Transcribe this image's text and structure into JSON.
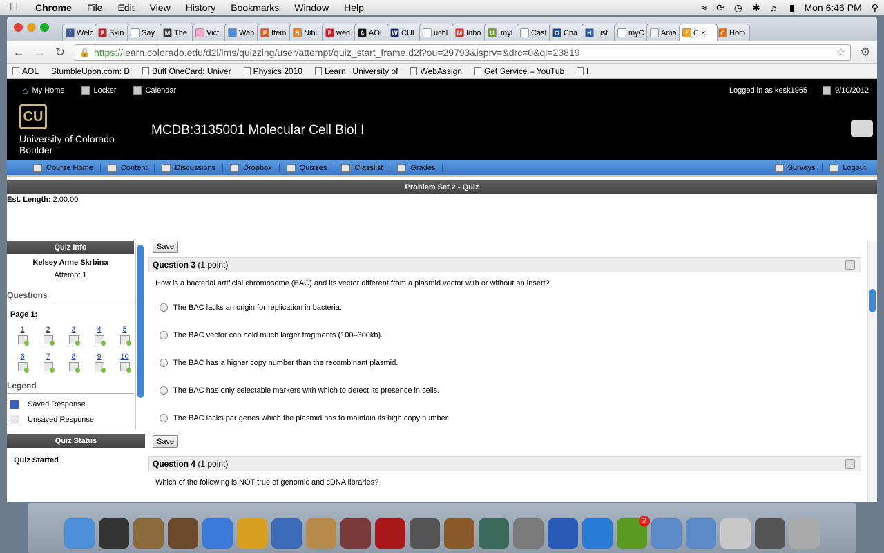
{
  "menubar": {
    "apple": "",
    "app_name": "Chrome",
    "items": [
      "File",
      "Edit",
      "View",
      "History",
      "Bookmarks",
      "Window",
      "Help"
    ],
    "clock": "Mon 6:46 PM"
  },
  "tabs": [
    {
      "label": "Welc",
      "color": "#3b5998",
      "glyph": "f"
    },
    {
      "label": "Skin",
      "color": "#cb2027",
      "glyph": "P"
    },
    {
      "label": "Say",
      "color": "#ffffff",
      "glyph": ""
    },
    {
      "label": "The",
      "color": "#333333",
      "glyph": "M"
    },
    {
      "label": "Vict",
      "color": "#f4a6c6",
      "glyph": ""
    },
    {
      "label": "Wan",
      "color": "#4a8fd8",
      "glyph": ""
    },
    {
      "label": "Item",
      "color": "#e0541c",
      "glyph": "E"
    },
    {
      "label": "Nibl",
      "color": "#f57d00",
      "glyph": "B"
    },
    {
      "label": "wed",
      "color": "#cb2027",
      "glyph": "P"
    },
    {
      "label": "AOL",
      "color": "#111111",
      "glyph": "A"
    },
    {
      "label": "CUL",
      "color": "#1a2b6d",
      "glyph": "W"
    },
    {
      "label": "ucbl",
      "color": "#ffffff",
      "glyph": ""
    },
    {
      "label": "Inbo",
      "color": "#d93025",
      "glyph": "M"
    },
    {
      "label": ".myl",
      "color": "#6aa121",
      "glyph": "U"
    },
    {
      "label": "Cast",
      "color": "#ffffff",
      "glyph": ""
    },
    {
      "label": "Cha",
      "color": "#0d4aa8",
      "glyph": "O"
    },
    {
      "label": "List",
      "color": "#2a5aa8",
      "glyph": "H"
    },
    {
      "label": "myC",
      "color": "#ffffff",
      "glyph": ""
    },
    {
      "label": "Ama",
      "color": "#f0f0f0",
      "glyph": "a"
    },
    {
      "label": "C",
      "color": "#f7a21b",
      "glyph": "*",
      "active": true
    },
    {
      "label": "Hom",
      "color": "#f06a00",
      "glyph": "C"
    }
  ],
  "toolbar": {
    "scheme": "https://",
    "url": "learn.colorado.edu/d2l/lms/quizzing/user/attempt/quiz_start_frame.d2l?ou=29793&isprv=&drc=0&qi=23819"
  },
  "bookmarks": [
    "AOL",
    "StumbleUpon.com: D",
    "Buff OneCard: Univer",
    "Physics 2010",
    "Learn | University of",
    "WebAssign",
    "Get Service – YouTub",
    "l"
  ],
  "d2l": {
    "my_home": "My Home",
    "locker": "Locker",
    "calendar": "Calendar",
    "logged_in": "Logged in as kesk1965",
    "date": "9/10/2012",
    "logo_line1": "University of Colorado",
    "logo_line2": "Boulder",
    "course_title": "MCDB:3135001 Molecular Cell Biol I",
    "nav": [
      "Course Home",
      "Content",
      "Discussions",
      "Dropbox",
      "Quizzes",
      "Classlist",
      "Grades"
    ],
    "nav_right": [
      "Surveys",
      "Logout"
    ]
  },
  "quiz": {
    "title": "Problem Set 2 - Quiz",
    "est_label": "Est. Length:",
    "est_value": "2:00:00",
    "info_head": "Quiz Info",
    "student": "Kelsey Anne Skrbina",
    "attempt": "Attempt 1",
    "questions_label": "Questions",
    "page_label": "Page 1:",
    "question_numbers": [
      "1",
      "2",
      "3",
      "4",
      "5",
      "6",
      "7",
      "8",
      "9",
      "10"
    ],
    "legend_label": "Legend",
    "legend_saved": "Saved Response",
    "legend_unsaved": "Unsaved Response",
    "status_head": "Quiz Status",
    "status_text": "Quiz Started",
    "save_label": "Save",
    "q3": {
      "title": "Question 3",
      "points": "(1 point)",
      "text": "How is a bacterial artificial chromosome (BAC) and its vector different from a plasmid vector with or without an insert?",
      "options": [
        "The BAC lacks an origin for replication in bacteria.",
        "The BAC vector can hold much larger fragments (100–300kb).",
        "The BAC has a higher copy number than the recombinant plasmid.",
        "The BAC has only selectable markers with which to detect its presence in cells.",
        "The BAC lacks par genes which the plasmid has to maintain its high copy number."
      ]
    },
    "q4": {
      "title": "Question 4",
      "points": "(1 point)",
      "text": "Which of the following is NOT true of genomic and cDNA libraries?"
    }
  },
  "dock": {
    "items": [
      {
        "name": "finder-icon",
        "color": "#4a8fd8"
      },
      {
        "name": "dashboard-icon",
        "color": "#333"
      },
      {
        "name": "mail-stamp-icon",
        "color": "#8a6a3a"
      },
      {
        "name": "iphoto-icon",
        "color": "#6a4a2a"
      },
      {
        "name": "safari-icon",
        "color": "#3a7ad8"
      },
      {
        "name": "chrome-icon",
        "color": "#d8a020"
      },
      {
        "name": "facetime-icon",
        "color": "#3a6ab8"
      },
      {
        "name": "address-book-icon",
        "color": "#b88a4a"
      },
      {
        "name": "photo-booth-icon",
        "color": "#7a3a3a"
      },
      {
        "name": "movie-icon",
        "color": "#a81818"
      },
      {
        "name": "imovie-icon",
        "color": "#555"
      },
      {
        "name": "garageband-icon",
        "color": "#8a5a2a"
      },
      {
        "name": "time-machine-icon",
        "color": "#3a6a5a"
      },
      {
        "name": "system-preferences-icon",
        "color": "#7a7a7a"
      },
      {
        "name": "word-icon",
        "color": "#2a5ab8"
      },
      {
        "name": "hp-icon",
        "color": "#2a7ad8"
      },
      {
        "name": "spotify-icon",
        "color": "#5a9a20",
        "badge": "2"
      },
      {
        "name": "applications-folder-icon",
        "color": "#5a8ac8"
      },
      {
        "name": "documents-folder-icon",
        "color": "#5a8ac8"
      },
      {
        "name": "stack-icon",
        "color": "#c8c8c8"
      },
      {
        "name": "downloads-icon",
        "color": "#555"
      },
      {
        "name": "trash-icon",
        "color": "#aaa"
      }
    ]
  }
}
